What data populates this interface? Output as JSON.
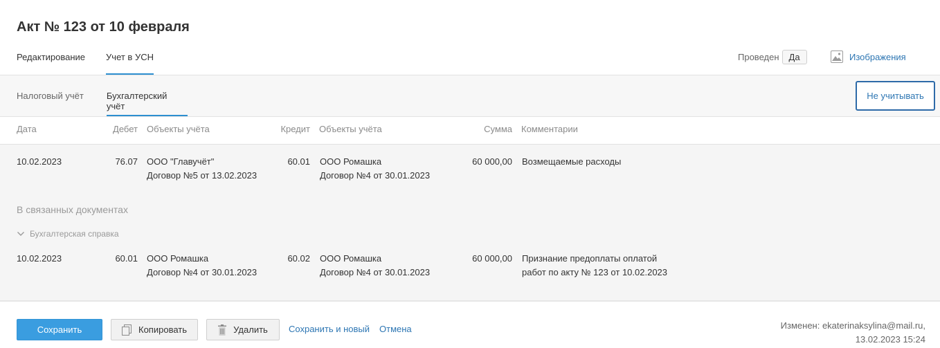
{
  "title": "Акт № 123 от 10 февраля",
  "main_tabs": [
    {
      "label": "Редактирование"
    },
    {
      "label": "Учет в УСН"
    }
  ],
  "posted": {
    "label": "Проведен",
    "value": "Да"
  },
  "images_link": "Изображения",
  "sub_tabs": [
    {
      "label": "Налоговый учёт"
    },
    {
      "label": "Бухгалтерский учёт"
    }
  ],
  "ignore_button": "Не учитывать",
  "columns": {
    "date": "Дата",
    "debit": "Дебет",
    "debit_objects": "Объекты учёта",
    "credit": "Кредит",
    "credit_objects": "Объекты учёта",
    "sum": "Сумма",
    "comments": "Комментарии"
  },
  "rows": [
    {
      "date": "10.02.2023",
      "debit": "76.07",
      "debit_obj1": "ООО \"Главучёт\"",
      "debit_obj2": "Договор №5 от 13.02.2023",
      "credit": "60.01",
      "credit_obj1": "ООО Ромашка",
      "credit_obj2": "Договор №4 от 30.01.2023",
      "sum": "60 000,00",
      "comment1": "Возмещаемые расходы",
      "comment2": ""
    }
  ],
  "related": {
    "title": "В связанных документах",
    "subtitle": "Бухгалтерская справка",
    "rows": [
      {
        "date": "10.02.2023",
        "debit": "60.01",
        "debit_obj1": "ООО Ромашка",
        "debit_obj2": "Договор №4 от 30.01.2023",
        "credit": "60.02",
        "credit_obj1": "ООО Ромашка",
        "credit_obj2": "Договор №4 от 30.01.2023",
        "sum": "60 000,00",
        "comment1": "Признание предоплаты оплатой",
        "comment2": "работ по акту № 123 от 10.02.2023"
      }
    ]
  },
  "footer": {
    "save": "Сохранить",
    "copy": "Копировать",
    "delete": "Удалить",
    "save_new": "Сохранить и новый",
    "cancel": "Отмена",
    "changed_line1": "Изменен: ekaterinaksylina@mail.ru,",
    "changed_line2": "13.02.2023 15:24"
  },
  "colors": {
    "accent": "#2d8fd0",
    "link": "#2d76b3",
    "primary_button": "#3a9de0"
  }
}
